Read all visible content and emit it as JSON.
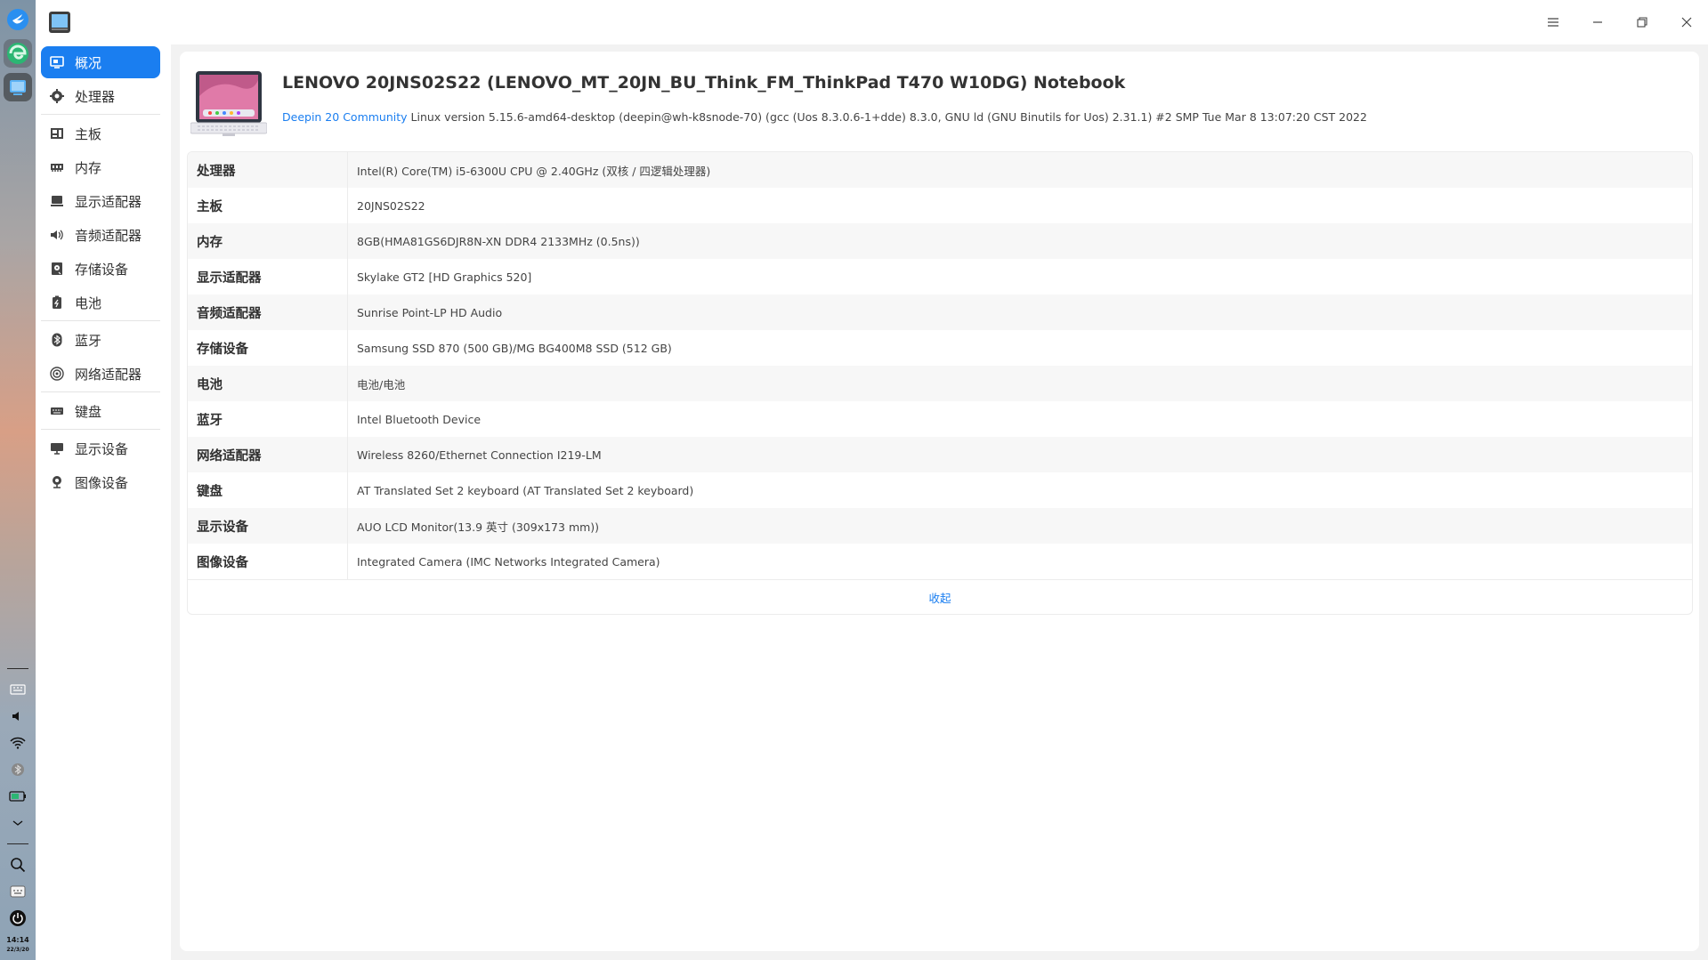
{
  "dock": {
    "apps": [
      {
        "name": "deepin-launcher",
        "icon": "deepin-logo-icon"
      },
      {
        "name": "browser",
        "icon": "browser-icon"
      },
      {
        "name": "device-manager",
        "icon": "device-manager-icon"
      }
    ],
    "tray": {
      "time": "14:14",
      "date": "22/3/20"
    }
  },
  "titlebar": {
    "app_icon": "device-manager-icon",
    "buttons": [
      "menu-icon",
      "minimize-icon",
      "maximize-icon",
      "close-icon"
    ]
  },
  "sidebar": {
    "items": [
      {
        "label": "概况",
        "icon": "overview-icon",
        "active": true
      },
      {
        "label": "处理器",
        "icon": "cpu-icon"
      },
      {
        "label": "主板",
        "icon": "motherboard-icon"
      },
      {
        "label": "内存",
        "icon": "memory-icon"
      },
      {
        "label": "显示适配器",
        "icon": "display-adapter-icon"
      },
      {
        "label": "音频适配器",
        "icon": "speaker-icon"
      },
      {
        "label": "存储设备",
        "icon": "storage-icon"
      },
      {
        "label": "电池",
        "icon": "battery-icon"
      },
      {
        "label": "蓝牙",
        "icon": "bluetooth-icon"
      },
      {
        "label": "网络适配器",
        "icon": "network-icon"
      },
      {
        "label": "键盘",
        "icon": "keyboard-icon"
      },
      {
        "label": "显示设备",
        "icon": "monitor-icon"
      },
      {
        "label": "图像设备",
        "icon": "camera-icon"
      }
    ]
  },
  "main": {
    "title": "LENOVO 20JNS02S22 (LENOVO_MT_20JN_BU_Think_FM_ThinkPad T470 W10DG) Notebook",
    "os_link": "Deepin 20 Community",
    "os_text": " Linux version 5.15.6-amd64-desktop (deepin@wh-k8snode-70) (gcc (Uos 8.3.0.6-1+dde) 8.3.0, GNU ld (GNU Binutils for Uos) 2.31.1) #2 SMP Tue Mar 8 13:07:20 CST 2022",
    "rows": [
      {
        "key": "处理器",
        "value": "Intel(R) Core(TM) i5-6300U CPU @ 2.40GHz (双核 / 四逻辑处理器)"
      },
      {
        "key": "主板",
        "value": "20JNS02S22"
      },
      {
        "key": "内存",
        "value": "8GB(HMA81GS6DJR8N-XN DDR4 2133MHz (0.5ns))"
      },
      {
        "key": "显示适配器",
        "value": "Skylake GT2 [HD Graphics 520]"
      },
      {
        "key": "音频适配器",
        "value": "Sunrise Point-LP HD Audio"
      },
      {
        "key": "存储设备",
        "value": "Samsung SSD 870 (500 GB)/MG  BG400M8  SSD (512 GB)"
      },
      {
        "key": "电池",
        "value": "电池/电池"
      },
      {
        "key": "蓝牙",
        "value": "Intel Bluetooth Device"
      },
      {
        "key": "网络适配器",
        "value": "Wireless 8260/Ethernet Connection I219-LM"
      },
      {
        "key": "键盘",
        "value": "AT Translated Set 2 keyboard (AT Translated Set 2 keyboard)"
      },
      {
        "key": "显示设备",
        "value": "AUO LCD Monitor(13.9 英寸 (309x173 mm))"
      },
      {
        "key": "图像设备",
        "value": "Integrated Camera (IMC Networks Integrated Camera)"
      }
    ],
    "collapse_label": "收起"
  },
  "colors": {
    "accent": "#1a7ef0",
    "text": "#303030"
  }
}
